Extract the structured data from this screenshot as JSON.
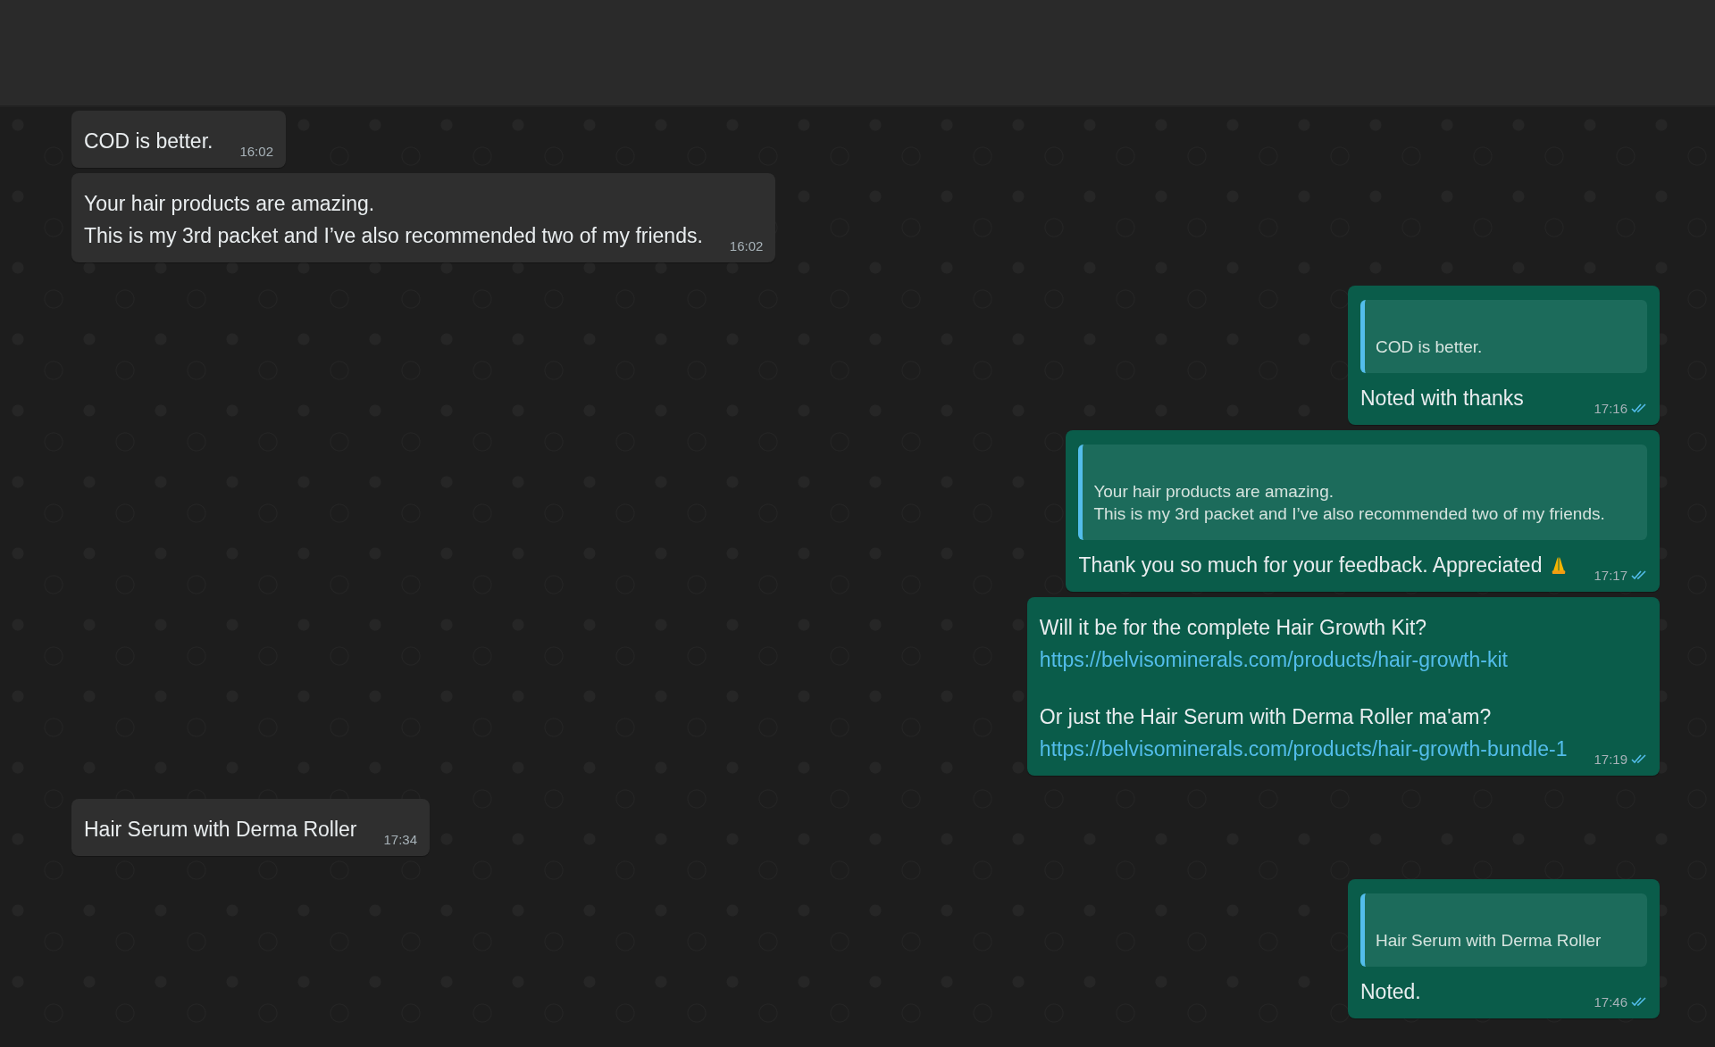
{
  "messages": [
    {
      "kind": "incoming",
      "paragraphs": [
        [
          "COD is better."
        ]
      ],
      "time": "16:02"
    },
    {
      "kind": "incoming",
      "paragraphs": [
        [
          "Your hair products are amazing.",
          "This is my 3rd packet and I’ve also recommended two of my friends."
        ]
      ],
      "time": "16:02"
    },
    {
      "kind": "outgoing",
      "quote": "COD is better.",
      "paragraphs": [
        [
          "Noted with thanks"
        ]
      ],
      "time": "17:16",
      "read": true
    },
    {
      "kind": "outgoing",
      "quote": "Your hair products are amazing.\nThis is my 3rd packet and I’ve also recommended two of my friends.",
      "paragraphs": [
        [
          "Thank you so much for your feedback. Appreciated"
        ]
      ],
      "prayer_emoji": true,
      "time": "17:17",
      "read": true
    },
    {
      "kind": "outgoing",
      "paragraphs": [
        [
          "Will it be for the complete Hair Growth Kit?",
          {
            "kind": "link",
            "text": "https://belvisominerals.com/products/hair-growth-kit"
          }
        ],
        [
          "Or just the Hair Serum with Derma Roller ma'am?",
          {
            "kind": "link",
            "text": "https://belvisominerals.com/products/hair-growth-bundle-1"
          }
        ]
      ],
      "time": "17:19",
      "read": true
    },
    {
      "kind": "incoming",
      "paragraphs": [
        [
          "Hair Serum with Derma Roller"
        ]
      ],
      "time": "17:34"
    },
    {
      "kind": "outgoing",
      "quote": "Hair Serum with Derma Roller",
      "paragraphs": [
        [
          "Noted."
        ]
      ],
      "time": "17:46",
      "read": true
    }
  ]
}
